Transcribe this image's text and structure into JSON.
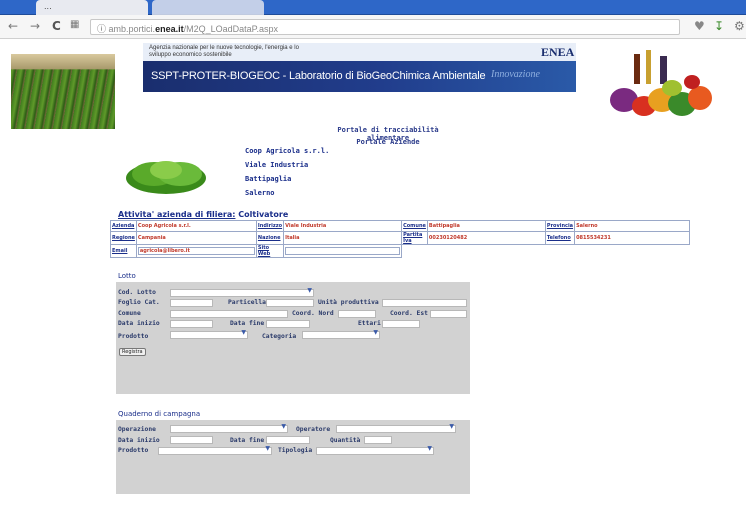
{
  "browser": {
    "tab_label": "...",
    "url_prefix": "amb.portici.",
    "url_domain": "enea.it",
    "url_path": "/M2Q_LOadDataP.aspx",
    "nav_back": "←",
    "nav_forward": "→",
    "nav_reload": "C"
  },
  "banner": {
    "subtitle": "Agenzia nazionale per le nuove tecnologie, l'energia e lo sviluppo economico sostenibile",
    "title": "SSPT-PROTER-BIOGEOC - Laboratorio di BioGeoChimica Ambientale",
    "logo": "ENEA",
    "innovation": "Innovazione"
  },
  "headings": {
    "portal": "Portale di tracciabilità alimentare",
    "subportal": "Portale Aziende"
  },
  "company": {
    "name": "Coop Agricola s.r.l.",
    "street": "Viale Industria",
    "city": "Battipaglia",
    "province": "Salerno"
  },
  "activity": {
    "label": "Attivita' azienda di filiera:",
    "value": "Coltivatore"
  },
  "info": {
    "azienda_label": "Azienda",
    "azienda": "Coop Agricola s.r.l.",
    "indirizzo_label": "Indirizzo",
    "indirizzo": "Viale Industria",
    "comune_label": "Comune",
    "comune": "Battipaglia",
    "provincia_label": "Provincia",
    "provincia": "Salerno",
    "regione_label": "Regione",
    "regione": "Campania",
    "nazione_label": "Nazione",
    "nazione": "Italia",
    "piva_label": "Partita Iva",
    "piva": "00230120482",
    "telefono_label": "Telefono",
    "telefono": "0815534231",
    "email_label": "Email",
    "email": "agricola@libero.it",
    "sito_label": "Sito Web",
    "sito": ""
  },
  "lotto": {
    "title": "Lotto",
    "cod_lotto": "Cod. Lotto",
    "foglio_cat": "Foglio Cat.",
    "particella": "Particella",
    "unita_produttiva": "Unità produttiva",
    "comune": "Comune",
    "coord_nord": "Coord. Nord",
    "coord_est": "Coord. Est",
    "data_inizio": "Data inizio",
    "data_fine": "Data fine",
    "ettari": "Ettari",
    "prodotto": "Prodotto",
    "categoria": "Categoria",
    "registra": "Registra"
  },
  "quaderno": {
    "title": "Quaderno di campagna",
    "operazione": "Operazione",
    "operatore": "Operatore",
    "data_inizio": "Data inizio",
    "data_fine": "Data fine",
    "quantita": "Quantità",
    "prodotto": "Prodotto",
    "tipologia": "Tipologia"
  }
}
